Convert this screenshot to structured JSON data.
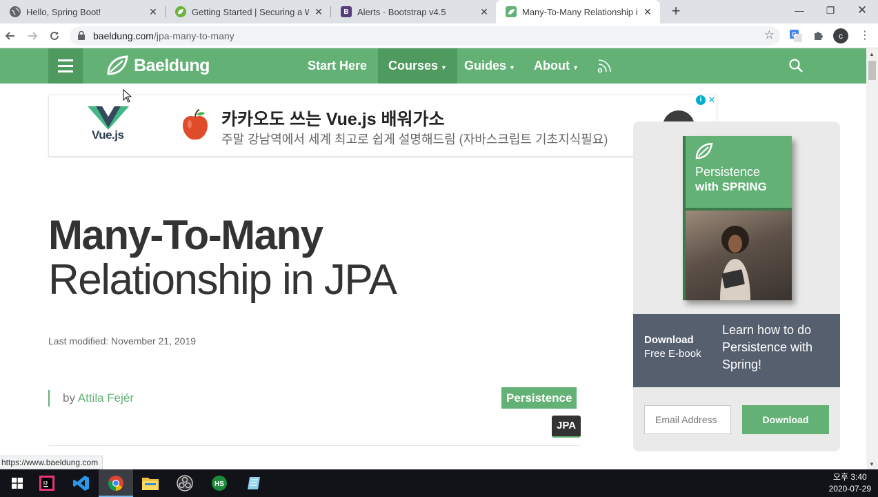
{
  "browser": {
    "tabs": [
      {
        "title": "Hello, Spring Boot!",
        "active": false
      },
      {
        "title": "Getting Started | Securing a Web",
        "active": false
      },
      {
        "title": "Alerts · Bootstrap v4.5",
        "active": false
      },
      {
        "title": "Many-To-Many Relationship in JPA",
        "active": true
      }
    ],
    "url_domain": "baeldung.com",
    "url_path": "/jpa-many-to-many",
    "profile_initial": "c",
    "status_url": "https://www.baeldung.com"
  },
  "site": {
    "logo": "Baeldung",
    "nav": [
      {
        "label": "Start Here",
        "dropdown": false
      },
      {
        "label": "Courses",
        "dropdown": true
      },
      {
        "label": "Guides",
        "dropdown": true
      },
      {
        "label": "About",
        "dropdown": true
      }
    ],
    "brand_color": "#63b175"
  },
  "ad": {
    "logo_text": "Vue.js",
    "title": "카카오도 쓰는 Vue.js 배워가소",
    "subtitle": "주말 강남역에서 세계 최고로 쉽게 설명해드림 (자바스크립트 기초지식필요)"
  },
  "article": {
    "title_bold": "Many-To-Many",
    "title_light": "Relationship in JPA",
    "last_modified": "Last modified: November 21, 2019",
    "by": "by",
    "author": "Attila Fejér",
    "tags": [
      "Persistence",
      "JPA"
    ]
  },
  "promo": {
    "book_line1": "Persistence",
    "book_line2": "with SPRING",
    "download": "Download",
    "free_ebook": "Free E-book",
    "learn": "Learn how to do Persistence with Spring!",
    "email_placeholder": "Email Address",
    "button": "Download"
  },
  "taskbar": {
    "time": "오후 3:40",
    "date": "2020-07-29"
  }
}
